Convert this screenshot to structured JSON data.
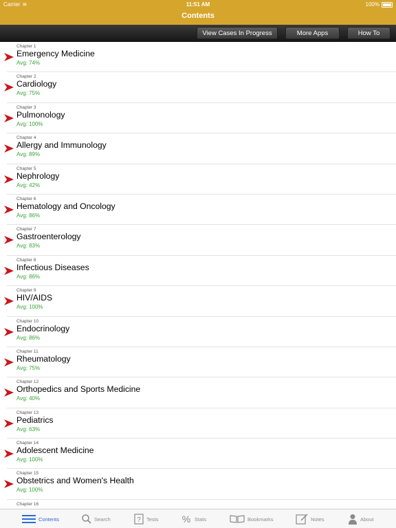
{
  "status": {
    "carrier": "Carrier",
    "time": "11:51 AM",
    "battery": "100%"
  },
  "nav": {
    "title": "Contents"
  },
  "toolbar": {
    "view_cases": "View Cases In Progress",
    "more_apps": "More Apps",
    "how_to": "How To"
  },
  "chapters": [
    {
      "num": "Chapter 1",
      "title": "Emergency Medicine",
      "avg": "Avg: 74%"
    },
    {
      "num": "Chapter 2",
      "title": "Cardiology",
      "avg": "Avg: 75%"
    },
    {
      "num": "Chapter 3",
      "title": "Pulmonology",
      "avg": "Avg: 100%"
    },
    {
      "num": "Chapter 4",
      "title": "Allergy and Immunology",
      "avg": "Avg: 89%"
    },
    {
      "num": "Chapter 5",
      "title": "Nephrology",
      "avg": "Avg: 42%"
    },
    {
      "num": "Chapter 6",
      "title": "Hematology and Oncology",
      "avg": "Avg: 86%"
    },
    {
      "num": "Chapter 7",
      "title": "Gastroenterology",
      "avg": "Avg: 83%"
    },
    {
      "num": "Chapter 8",
      "title": "Infectious Diseases",
      "avg": "Avg: 86%"
    },
    {
      "num": "Chapter 9",
      "title": "HIV/AIDS",
      "avg": "Avg: 100%"
    },
    {
      "num": "Chapter 10",
      "title": "Endocrinology",
      "avg": "Avg: 86%"
    },
    {
      "num": "Chapter 11",
      "title": "Rheumatology",
      "avg": "Avg: 75%"
    },
    {
      "num": "Chapter 12",
      "title": "Orthopedics and Sports Medicine",
      "avg": "Avg: 40%"
    },
    {
      "num": "Chapter 13",
      "title": "Pediatrics",
      "avg": "Avg: 63%"
    },
    {
      "num": "Chapter 14",
      "title": "Adolescent Medicine",
      "avg": "Avg: 100%"
    },
    {
      "num": "Chapter 15",
      "title": "Obstetrics and Women's Health",
      "avg": "Avg: 100%"
    },
    {
      "num": "Chapter 16",
      "title": "",
      "avg": ""
    }
  ],
  "tabs": [
    {
      "label": "Contents",
      "icon": "list-icon",
      "active": true
    },
    {
      "label": "Search",
      "icon": "search-icon",
      "active": false
    },
    {
      "label": "Tests",
      "icon": "question-icon",
      "active": false
    },
    {
      "label": "Stats",
      "icon": "percent-icon",
      "active": false
    },
    {
      "label": "Bookmarks",
      "icon": "book-icon",
      "active": false
    },
    {
      "label": "Notes",
      "icon": "note-icon",
      "active": false
    },
    {
      "label": "About",
      "icon": "person-icon",
      "active": false
    }
  ],
  "colors": {
    "nav": "#d6a52c",
    "avg": "#3aa53a",
    "arrow": "#c8161d",
    "active_tab": "#2a6bd0"
  }
}
